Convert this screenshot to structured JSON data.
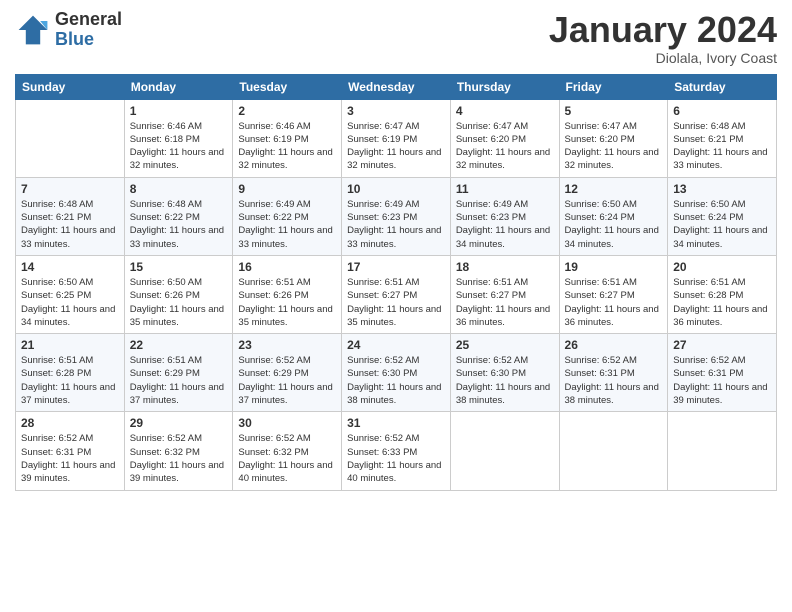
{
  "logo": {
    "general": "General",
    "blue": "Blue"
  },
  "title": "January 2024",
  "location": "Diolala, Ivory Coast",
  "days_of_week": [
    "Sunday",
    "Monday",
    "Tuesday",
    "Wednesday",
    "Thursday",
    "Friday",
    "Saturday"
  ],
  "weeks": [
    [
      {
        "day": "",
        "info": ""
      },
      {
        "day": "1",
        "sunrise": "Sunrise: 6:46 AM",
        "sunset": "Sunset: 6:18 PM",
        "daylight": "Daylight: 11 hours and 32 minutes."
      },
      {
        "day": "2",
        "sunrise": "Sunrise: 6:46 AM",
        "sunset": "Sunset: 6:19 PM",
        "daylight": "Daylight: 11 hours and 32 minutes."
      },
      {
        "day": "3",
        "sunrise": "Sunrise: 6:47 AM",
        "sunset": "Sunset: 6:19 PM",
        "daylight": "Daylight: 11 hours and 32 minutes."
      },
      {
        "day": "4",
        "sunrise": "Sunrise: 6:47 AM",
        "sunset": "Sunset: 6:20 PM",
        "daylight": "Daylight: 11 hours and 32 minutes."
      },
      {
        "day": "5",
        "sunrise": "Sunrise: 6:47 AM",
        "sunset": "Sunset: 6:20 PM",
        "daylight": "Daylight: 11 hours and 32 minutes."
      },
      {
        "day": "6",
        "sunrise": "Sunrise: 6:48 AM",
        "sunset": "Sunset: 6:21 PM",
        "daylight": "Daylight: 11 hours and 33 minutes."
      }
    ],
    [
      {
        "day": "7",
        "sunrise": "Sunrise: 6:48 AM",
        "sunset": "Sunset: 6:21 PM",
        "daylight": "Daylight: 11 hours and 33 minutes."
      },
      {
        "day": "8",
        "sunrise": "Sunrise: 6:48 AM",
        "sunset": "Sunset: 6:22 PM",
        "daylight": "Daylight: 11 hours and 33 minutes."
      },
      {
        "day": "9",
        "sunrise": "Sunrise: 6:49 AM",
        "sunset": "Sunset: 6:22 PM",
        "daylight": "Daylight: 11 hours and 33 minutes."
      },
      {
        "day": "10",
        "sunrise": "Sunrise: 6:49 AM",
        "sunset": "Sunset: 6:23 PM",
        "daylight": "Daylight: 11 hours and 33 minutes."
      },
      {
        "day": "11",
        "sunrise": "Sunrise: 6:49 AM",
        "sunset": "Sunset: 6:23 PM",
        "daylight": "Daylight: 11 hours and 34 minutes."
      },
      {
        "day": "12",
        "sunrise": "Sunrise: 6:50 AM",
        "sunset": "Sunset: 6:24 PM",
        "daylight": "Daylight: 11 hours and 34 minutes."
      },
      {
        "day": "13",
        "sunrise": "Sunrise: 6:50 AM",
        "sunset": "Sunset: 6:24 PM",
        "daylight": "Daylight: 11 hours and 34 minutes."
      }
    ],
    [
      {
        "day": "14",
        "sunrise": "Sunrise: 6:50 AM",
        "sunset": "Sunset: 6:25 PM",
        "daylight": "Daylight: 11 hours and 34 minutes."
      },
      {
        "day": "15",
        "sunrise": "Sunrise: 6:50 AM",
        "sunset": "Sunset: 6:26 PM",
        "daylight": "Daylight: 11 hours and 35 minutes."
      },
      {
        "day": "16",
        "sunrise": "Sunrise: 6:51 AM",
        "sunset": "Sunset: 6:26 PM",
        "daylight": "Daylight: 11 hours and 35 minutes."
      },
      {
        "day": "17",
        "sunrise": "Sunrise: 6:51 AM",
        "sunset": "Sunset: 6:27 PM",
        "daylight": "Daylight: 11 hours and 35 minutes."
      },
      {
        "day": "18",
        "sunrise": "Sunrise: 6:51 AM",
        "sunset": "Sunset: 6:27 PM",
        "daylight": "Daylight: 11 hours and 36 minutes."
      },
      {
        "day": "19",
        "sunrise": "Sunrise: 6:51 AM",
        "sunset": "Sunset: 6:27 PM",
        "daylight": "Daylight: 11 hours and 36 minutes."
      },
      {
        "day": "20",
        "sunrise": "Sunrise: 6:51 AM",
        "sunset": "Sunset: 6:28 PM",
        "daylight": "Daylight: 11 hours and 36 minutes."
      }
    ],
    [
      {
        "day": "21",
        "sunrise": "Sunrise: 6:51 AM",
        "sunset": "Sunset: 6:28 PM",
        "daylight": "Daylight: 11 hours and 37 minutes."
      },
      {
        "day": "22",
        "sunrise": "Sunrise: 6:51 AM",
        "sunset": "Sunset: 6:29 PM",
        "daylight": "Daylight: 11 hours and 37 minutes."
      },
      {
        "day": "23",
        "sunrise": "Sunrise: 6:52 AM",
        "sunset": "Sunset: 6:29 PM",
        "daylight": "Daylight: 11 hours and 37 minutes."
      },
      {
        "day": "24",
        "sunrise": "Sunrise: 6:52 AM",
        "sunset": "Sunset: 6:30 PM",
        "daylight": "Daylight: 11 hours and 38 minutes."
      },
      {
        "day": "25",
        "sunrise": "Sunrise: 6:52 AM",
        "sunset": "Sunset: 6:30 PM",
        "daylight": "Daylight: 11 hours and 38 minutes."
      },
      {
        "day": "26",
        "sunrise": "Sunrise: 6:52 AM",
        "sunset": "Sunset: 6:31 PM",
        "daylight": "Daylight: 11 hours and 38 minutes."
      },
      {
        "day": "27",
        "sunrise": "Sunrise: 6:52 AM",
        "sunset": "Sunset: 6:31 PM",
        "daylight": "Daylight: 11 hours and 39 minutes."
      }
    ],
    [
      {
        "day": "28",
        "sunrise": "Sunrise: 6:52 AM",
        "sunset": "Sunset: 6:31 PM",
        "daylight": "Daylight: 11 hours and 39 minutes."
      },
      {
        "day": "29",
        "sunrise": "Sunrise: 6:52 AM",
        "sunset": "Sunset: 6:32 PM",
        "daylight": "Daylight: 11 hours and 39 minutes."
      },
      {
        "day": "30",
        "sunrise": "Sunrise: 6:52 AM",
        "sunset": "Sunset: 6:32 PM",
        "daylight": "Daylight: 11 hours and 40 minutes."
      },
      {
        "day": "31",
        "sunrise": "Sunrise: 6:52 AM",
        "sunset": "Sunset: 6:33 PM",
        "daylight": "Daylight: 11 hours and 40 minutes."
      },
      {
        "day": "",
        "info": ""
      },
      {
        "day": "",
        "info": ""
      },
      {
        "day": "",
        "info": ""
      }
    ]
  ]
}
